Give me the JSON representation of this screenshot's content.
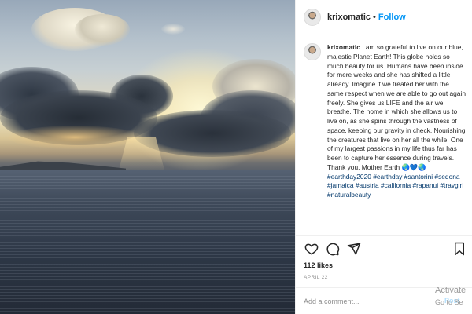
{
  "post": {
    "username": "krixomatic",
    "follow_label": "Follow",
    "separator": "•",
    "caption": {
      "text": "I am so grateful to live on our blue, majestic Planet Earth! This globe holds so much beauty for us. Humans have been inside for mere weeks and she has shifted a little already. Imagine if we treated her with the same respect when we are able to go out again freely. She gives us LIFE and the air we breathe. The home in which she allows us to live on, as she spins through the vastness of space, keeping our gravity in check. Nourishing the creatures that live on her all the while. One of my largest passions in my life thus far has been to capture her essence during travels. Thank you, Mother Earth 🌏💙🌏",
      "hashtags": "#earthday2020 #earthday #santorini #sedona #jamaica #austria #california #rapanui #travgirl #naturalbeauty"
    },
    "likes": "112 likes",
    "date": "APRIL 22",
    "comment_placeholder": "Add a comment...",
    "post_label": "Post"
  },
  "icons": {
    "like": "heart-icon",
    "comment": "comment-icon",
    "share": "share-icon",
    "save": "bookmark-icon"
  },
  "os_overlay": {
    "line1": "Activate",
    "line2": "Go to Se"
  },
  "colors": {
    "follow": "#0095f6",
    "hashtag": "#00376b",
    "muted": "#8e8e8e"
  }
}
